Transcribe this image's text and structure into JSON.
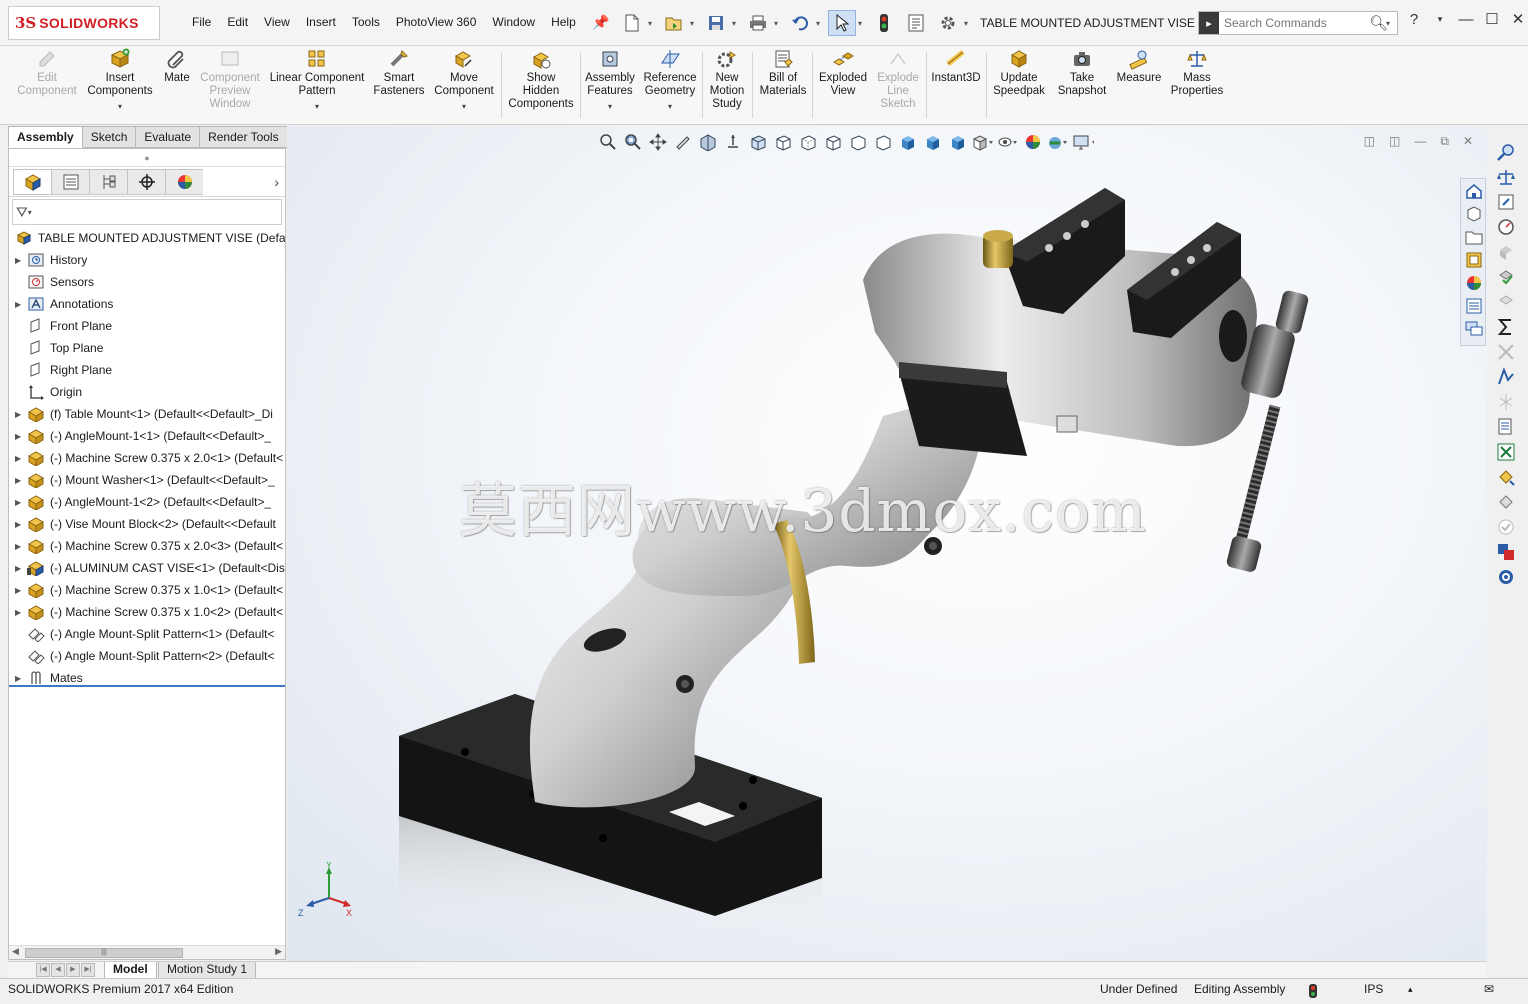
{
  "app": {
    "logo_brand": "3DS SOLIDWORKS",
    "logo_ds": "3S",
    "logo_name": "SOLIDWORKS",
    "document_title": "TABLE MOUNTED ADJUSTMENT VISE *",
    "accent": "#d21f24"
  },
  "menu": [
    "File",
    "Edit",
    "View",
    "Insert",
    "Tools",
    "PhotoView 360",
    "Window",
    "Help"
  ],
  "search": {
    "placeholder": "Search Commands",
    "value": ""
  },
  "command_manager": {
    "edit_component": "Edit\nComponent",
    "insert_components": "Insert\nComponents",
    "mate": "Mate",
    "component_preview": "Component\nPreview\nWindow",
    "linear_pattern": "Linear Component\nPattern",
    "smart_fasteners": "Smart\nFasteners",
    "move_component": "Move\nComponent",
    "show_hidden": "Show\nHidden\nComponents",
    "assembly_features": "Assembly\nFeatures",
    "reference_geometry": "Reference\nGeometry",
    "new_motion_study": "New\nMotion\nStudy",
    "bill_of_materials": "Bill of\nMaterials",
    "exploded_view": "Exploded\nView",
    "explode_line_sketch": "Explode\nLine\nSketch",
    "instant3d": "Instant3D",
    "update_speedpak": "Update\nSpeedpak",
    "take_snapshot": "Take\nSnapshot",
    "measure": "Measure",
    "mass_properties": "Mass\nProperties"
  },
  "cm_tabs": [
    "Assembly",
    "Sketch",
    "Evaluate",
    "Render Tools"
  ],
  "tree": {
    "root": "TABLE MOUNTED ADJUSTMENT VISE  (Default<",
    "history": "History",
    "sensors": "Sensors",
    "annotations": "Annotations",
    "front_plane": "Front Plane",
    "top_plane": "Top Plane",
    "right_plane": "Right Plane",
    "origin": "Origin",
    "c1": "(f) Table Mount<1> (Default<<Default>_Di",
    "c2": "(-) AngleMount-1<1> (Default<<Default>_",
    "c3": "(-) Machine Screw 0.375 x 2.0<1> (Default<",
    "c4": "(-) Mount Washer<1> (Default<<Default>_",
    "c5": "(-) AngleMount-1<2> (Default<<Default>_",
    "c6": "(-) Vise Mount Block<2> (Default<<Default",
    "c7": "(-) Machine Screw 0.375 x 2.0<3> (Default<",
    "c8": "(-) ALUMINUM CAST VISE<1> (Default<Dis",
    "c9": "(-) Machine Screw 0.375 x 1.0<1> (Default<",
    "c10": "(-) Machine Screw 0.375 x 1.0<2> (Default<",
    "c11": "(-) Angle Mount-Split Pattern<1> (Default<",
    "c12": "(-) Angle Mount-Split Pattern<2> (Default<",
    "mates": "Mates"
  },
  "graphics": {
    "watermark": "莫西网www.3dmox.com",
    "triad_x": "X",
    "triad_y": "Y",
    "triad_z": "Z"
  },
  "bottom_tabs": [
    "Model",
    "Motion Study 1"
  ],
  "status": {
    "edition": "SOLIDWORKS Premium 2017 x64 Edition",
    "definition": "Under Defined",
    "mode": "Editing Assembly",
    "units": "IPS"
  }
}
